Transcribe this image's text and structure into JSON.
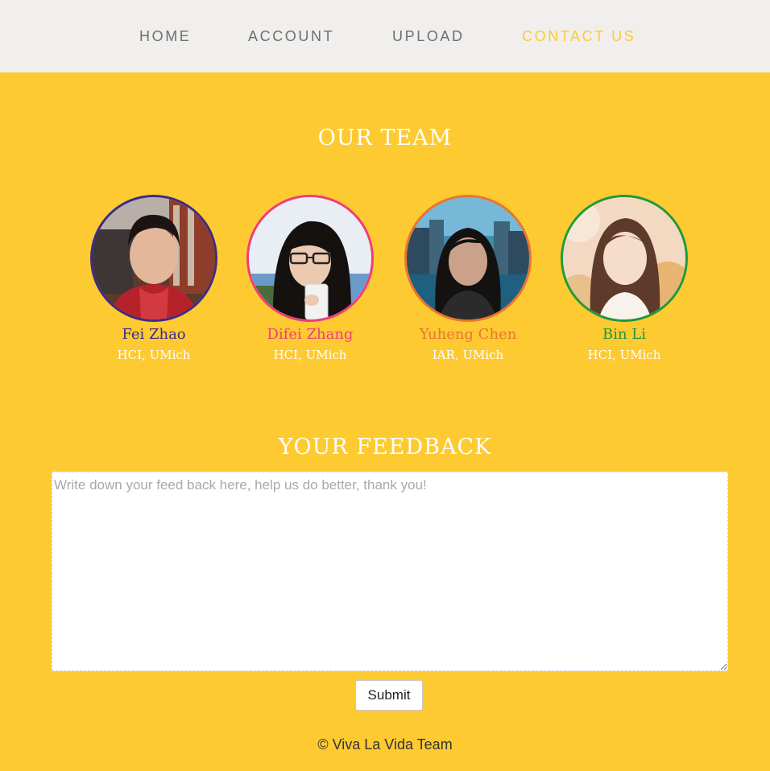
{
  "nav": {
    "items": [
      {
        "label": "HOME"
      },
      {
        "label": "ACCOUNT"
      },
      {
        "label": "UPLOAD"
      },
      {
        "label": "CONTACT US"
      }
    ],
    "active": "CONTACT US"
  },
  "team": {
    "title": "OUR TEAM",
    "members": [
      {
        "name": "Fei Zhao",
        "role": "HCI, UMich",
        "color": "#3f2b86"
      },
      {
        "name": "Difei Zhang",
        "role": "HCI, UMich",
        "color": "#f13c7a"
      },
      {
        "name": "Yuheng Chen",
        "role": "IAR, UMich",
        "color": "#e87530"
      },
      {
        "name": "Bin Li",
        "role": "HCI, UMich",
        "color": "#1e9a3d"
      }
    ]
  },
  "feedback": {
    "title": "YOUR FEEDBACK",
    "placeholder": "Write down your feed back here, help us do better, thank you!",
    "submit_label": "Submit"
  },
  "footer": {
    "text": "©  Viva La Vida Team"
  },
  "colors": {
    "background": "#fdca32",
    "navbar": "#f0efed",
    "nav_text": "#6e6e6e",
    "nav_active": "#fdca32"
  }
}
